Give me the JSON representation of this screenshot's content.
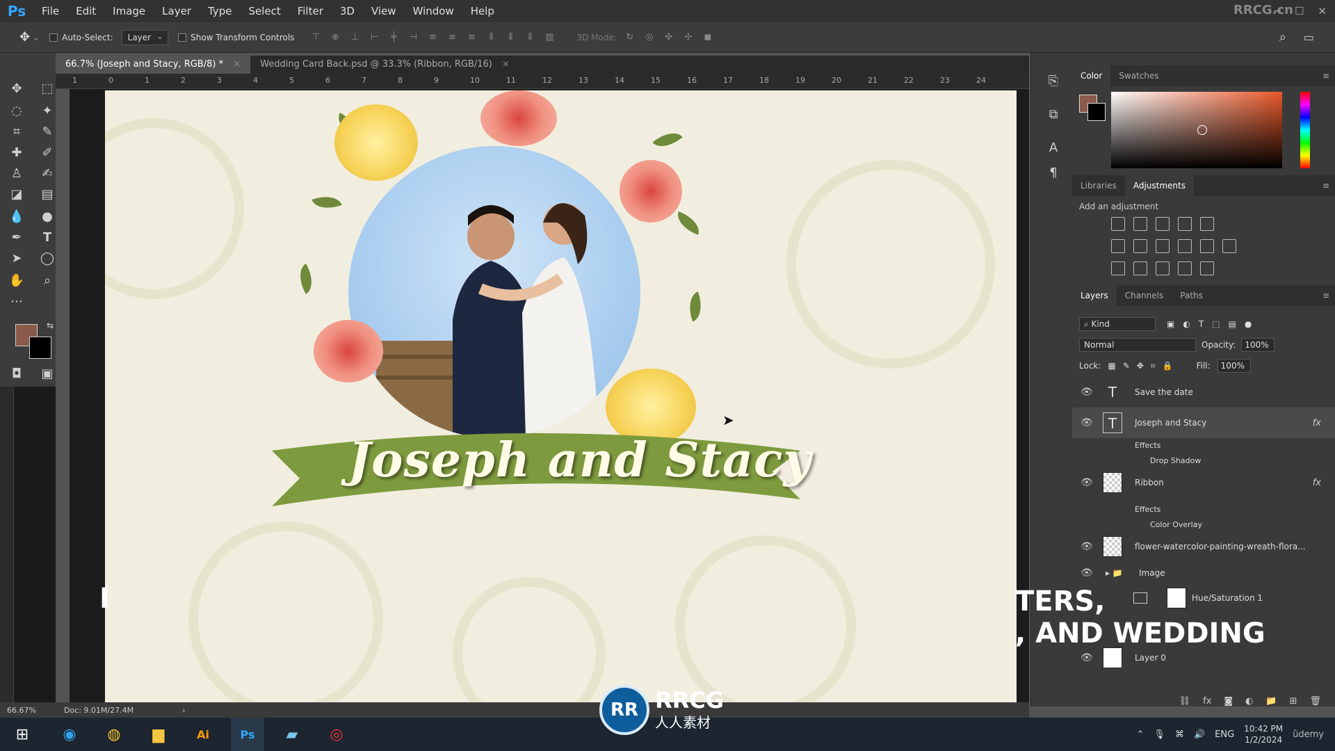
{
  "app": {
    "logo": "Ps",
    "brand_watermark": "RRCG.cn"
  },
  "menu": [
    "File",
    "Edit",
    "Image",
    "Layer",
    "Type",
    "Select",
    "Filter",
    "3D",
    "View",
    "Window",
    "Help"
  ],
  "options": {
    "auto_select_label": "Auto-Select:",
    "auto_select_value": "Layer",
    "show_transform_label": "Show Transform Controls",
    "mode_3d_label": "3D Mode:"
  },
  "tabs": [
    {
      "label": "66.7% (Joseph  and Stacy, RGB/8) *",
      "active": true
    },
    {
      "label": "Wedding Card Back.psd @ 33.3% (Ribbon, RGB/16)",
      "active": false
    }
  ],
  "ruler_ticks": [
    "1",
    "0",
    "1",
    "2",
    "3",
    "4",
    "5",
    "6",
    "7",
    "8",
    "9",
    "10",
    "11",
    "12",
    "13",
    "14",
    "15",
    "16",
    "17",
    "18",
    "19",
    "20",
    "21",
    "22",
    "23",
    "24"
  ],
  "canvas": {
    "couple_name": "Joseph and Stacy"
  },
  "overlay": {
    "left_text": "I",
    "right_line1": "TERS,",
    "right_line2": ", AND WEDDING"
  },
  "status": {
    "zoom": "66.67%",
    "doc": "Doc: 9.01M/27.4M"
  },
  "panels": {
    "color_tabs": [
      "Color",
      "Swatches"
    ],
    "adj_tabs": [
      "Libraries",
      "Adjustments"
    ],
    "adj_title": "Add an adjustment",
    "layer_tabs": [
      "Layers",
      "Channels",
      "Paths"
    ],
    "kind_label": "Kind",
    "blend_mode": "Normal",
    "opacity_label": "Opacity:",
    "opacity_value": "100%",
    "lock_label": "Lock:",
    "fill_label": "Fill:",
    "fill_value": "100%"
  },
  "layers": [
    {
      "name": "Save the date",
      "type": "text"
    },
    {
      "name": "Joseph  and Stacy",
      "type": "text",
      "fx": "fx",
      "effects_label": "Effects",
      "effect": "Drop Shadow",
      "selected": true
    },
    {
      "name": "Ribbon",
      "type": "raster",
      "fx": "fx",
      "effects_label": "Effects",
      "effect": "Color Overlay"
    },
    {
      "name": "flower-watercolor-painting-wreath-flora...",
      "type": "raster"
    },
    {
      "name": "Image",
      "type": "group"
    },
    {
      "name": "Hue/Saturation 1",
      "type": "adjustment"
    },
    {
      "name": "Layer 0",
      "type": "raster"
    }
  ],
  "taskbar": {
    "lang": "ENG",
    "time": "10:42 PM",
    "date": "1/2/2024",
    "udemy": "ûdemy"
  },
  "watermark": {
    "logo_text": "RR",
    "title": "RRCG",
    "subtitle": "人人素材"
  },
  "colors": {
    "accent_fg": "#8a5a4a",
    "ribbon_green": "#7e9a3e",
    "ps_blue": "#31a8ff"
  }
}
